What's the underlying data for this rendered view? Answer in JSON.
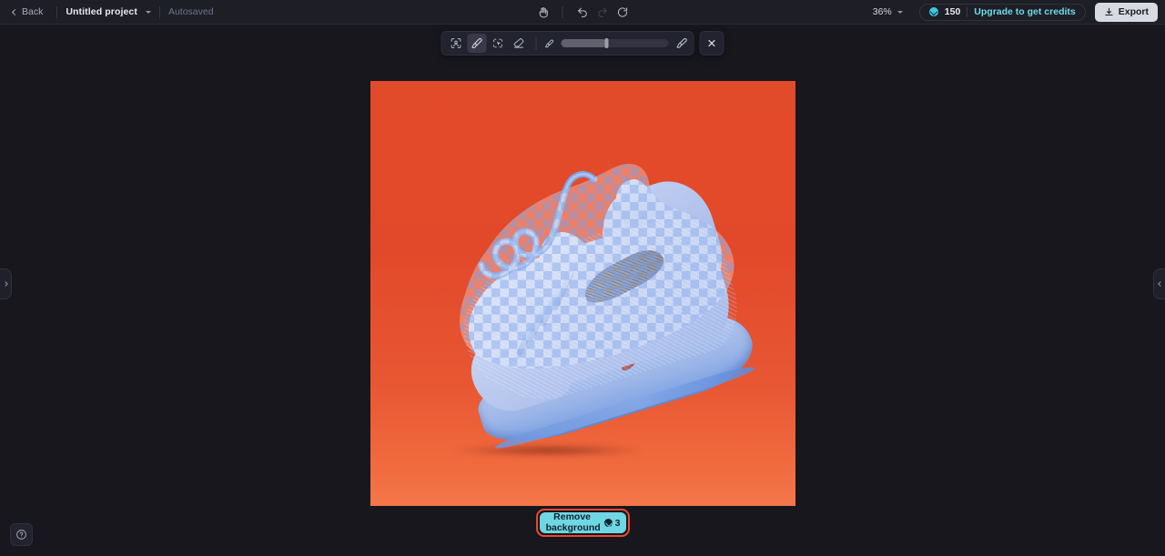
{
  "header": {
    "back_label": "Back",
    "project_name": "Untitled project",
    "project_caret_icon": "chevron-down-icon",
    "autosaved_label": "Autosaved",
    "pan_icon": "hand-pan-icon",
    "undo_icon": "undo-icon",
    "redo_icon": "redo-icon",
    "reset_icon": "reset-view-icon",
    "zoom_level": "36%",
    "zoom_caret_icon": "chevron-down-icon",
    "credits": {
      "coin_icon": "credit-coin-icon",
      "count": "150",
      "upgrade_label": "Upgrade to get credits",
      "accent_color": "#6ddbe8"
    },
    "export_label": "Export",
    "export_icon": "download-icon"
  },
  "toolbar": {
    "tools": [
      {
        "name": "subject-select-tool",
        "icon": "person-select-icon",
        "active": false
      },
      {
        "name": "brush-tool",
        "icon": "paint-brush-icon",
        "active": true
      },
      {
        "name": "magic-select-tool",
        "icon": "magic-lasso-icon",
        "active": false
      },
      {
        "name": "eraser-tool",
        "icon": "eraser-icon",
        "active": false
      }
    ],
    "brush_size": {
      "small_icon": "brush-small-icon",
      "large_icon": "brush-large-icon",
      "value_percent": 42
    },
    "close_icon": "close-x-icon"
  },
  "canvas": {
    "artboard_background": "#e24b29",
    "mask_color": "#8fb3f0",
    "left_panel_handle_icon": "chevron-right-icon",
    "right_panel_handle_icon": "chevron-left-icon"
  },
  "cta": {
    "label_line1": "Remove",
    "label_line2": "background",
    "cost": "3",
    "coin_icon": "credit-coin-icon",
    "button_color": "#6fd6e4",
    "focus_ring_color": "#f0482a"
  },
  "help": {
    "icon": "question-mark-circle-icon"
  }
}
